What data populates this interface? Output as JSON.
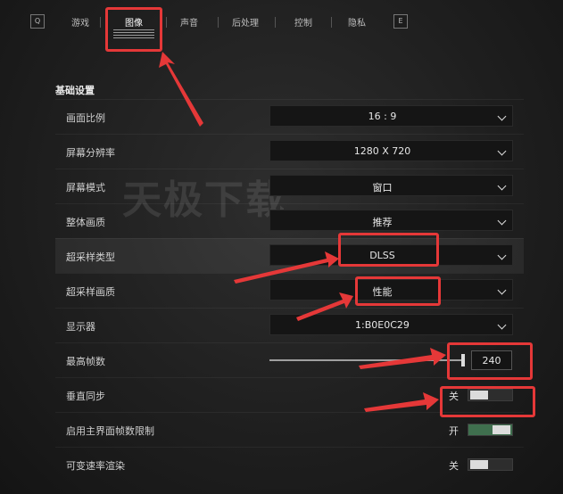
{
  "topbar": {
    "left_key": "Q",
    "right_key": "E",
    "tabs": [
      {
        "label": "游戏"
      },
      {
        "label": "图像"
      },
      {
        "label": "声音"
      },
      {
        "label": "后处理"
      },
      {
        "label": "控制"
      },
      {
        "label": "隐私"
      }
    ],
    "active_tab": "图像"
  },
  "section": {
    "title": "基础设置"
  },
  "settings": [
    {
      "label": "画面比例",
      "control": "dropdown",
      "value": "16 : 9"
    },
    {
      "label": "屏幕分辨率",
      "control": "dropdown",
      "value": "1280 X 720"
    },
    {
      "label": "屏幕模式",
      "control": "dropdown",
      "value": "窗口"
    },
    {
      "label": "整体画质",
      "control": "dropdown",
      "value": "推荐"
    },
    {
      "label": "超采样类型",
      "control": "dropdown",
      "value": "DLSS"
    },
    {
      "label": "超采样画质",
      "control": "dropdown",
      "value": "性能"
    },
    {
      "label": "显示器",
      "control": "dropdown",
      "value": "1:B0E0C29"
    },
    {
      "label": "最高帧数",
      "control": "slider",
      "value": "240",
      "fill_fraction": 1.0
    },
    {
      "label": "垂直同步",
      "control": "toggle",
      "state_text": "关",
      "on": false
    },
    {
      "label": "启用主界面帧数限制",
      "control": "toggle",
      "state_text": "开",
      "on": true
    },
    {
      "label": "可变速率渲染",
      "control": "toggle",
      "state_text": "关",
      "on": false
    }
  ],
  "watermark": "天极下载",
  "colors": {
    "highlight": "#e53838",
    "toggle_on": "#3f6f4e"
  }
}
